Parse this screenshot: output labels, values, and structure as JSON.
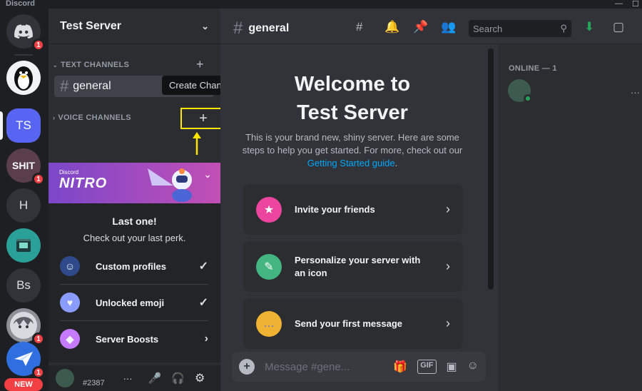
{
  "app": {
    "name": "Discord"
  },
  "servers": [
    {
      "name": "discord-home",
      "label": "",
      "badge": "1"
    },
    {
      "name": "penguin",
      "label": "",
      "badge": ""
    },
    {
      "name": "test-server",
      "label": "TS",
      "badge": ""
    },
    {
      "name": "shit-server",
      "label": "SHIT",
      "badge": "1"
    },
    {
      "name": "h-server",
      "label": "H",
      "badge": ""
    },
    {
      "name": "robot-server",
      "label": "",
      "badge": ""
    },
    {
      "name": "bs-server",
      "label": "Bs",
      "badge": ""
    },
    {
      "name": "anime-server",
      "label": "",
      "badge": "1"
    },
    {
      "name": "bird-server",
      "label": "",
      "badge": "1"
    }
  ],
  "new_badge": "NEW",
  "sidebar": {
    "server_name": "Test Server",
    "text_category": "TEXT CHANNELS",
    "voice_category": "VOICE CHANNELS",
    "channel": "general",
    "tooltip": "Create Channel"
  },
  "nitro": {
    "small_label": "Discord",
    "logo": "NITRO",
    "title": "Last one!",
    "subtitle": "Check out your last perk.",
    "perks": [
      {
        "label": "Custom profiles"
      },
      {
        "label": "Unlocked emoji"
      },
      {
        "label": "Server Boosts"
      }
    ]
  },
  "user": {
    "tag": "#2387"
  },
  "header": {
    "channel": "general",
    "search_placeholder": "Search"
  },
  "welcome": {
    "line1": "Welcome to",
    "line2": "Test Server",
    "intro": "This is your brand new, shiny server. Here are some steps to help you get started. For more, check out our",
    "link": "Getting Started guide",
    "period": ".",
    "cards": [
      {
        "label": "Invite your friends"
      },
      {
        "label": "Personalize your server with an icon"
      },
      {
        "label": "Send your first message"
      }
    ]
  },
  "composer": {
    "placeholder": "Message #gene..."
  },
  "members": {
    "heading": "ONLINE — 1"
  },
  "colors": {
    "blurple": "#5865f2",
    "online": "#23a55a",
    "alert": "#f23f43",
    "highlight": "#ffe600",
    "link": "#00a8fc"
  }
}
